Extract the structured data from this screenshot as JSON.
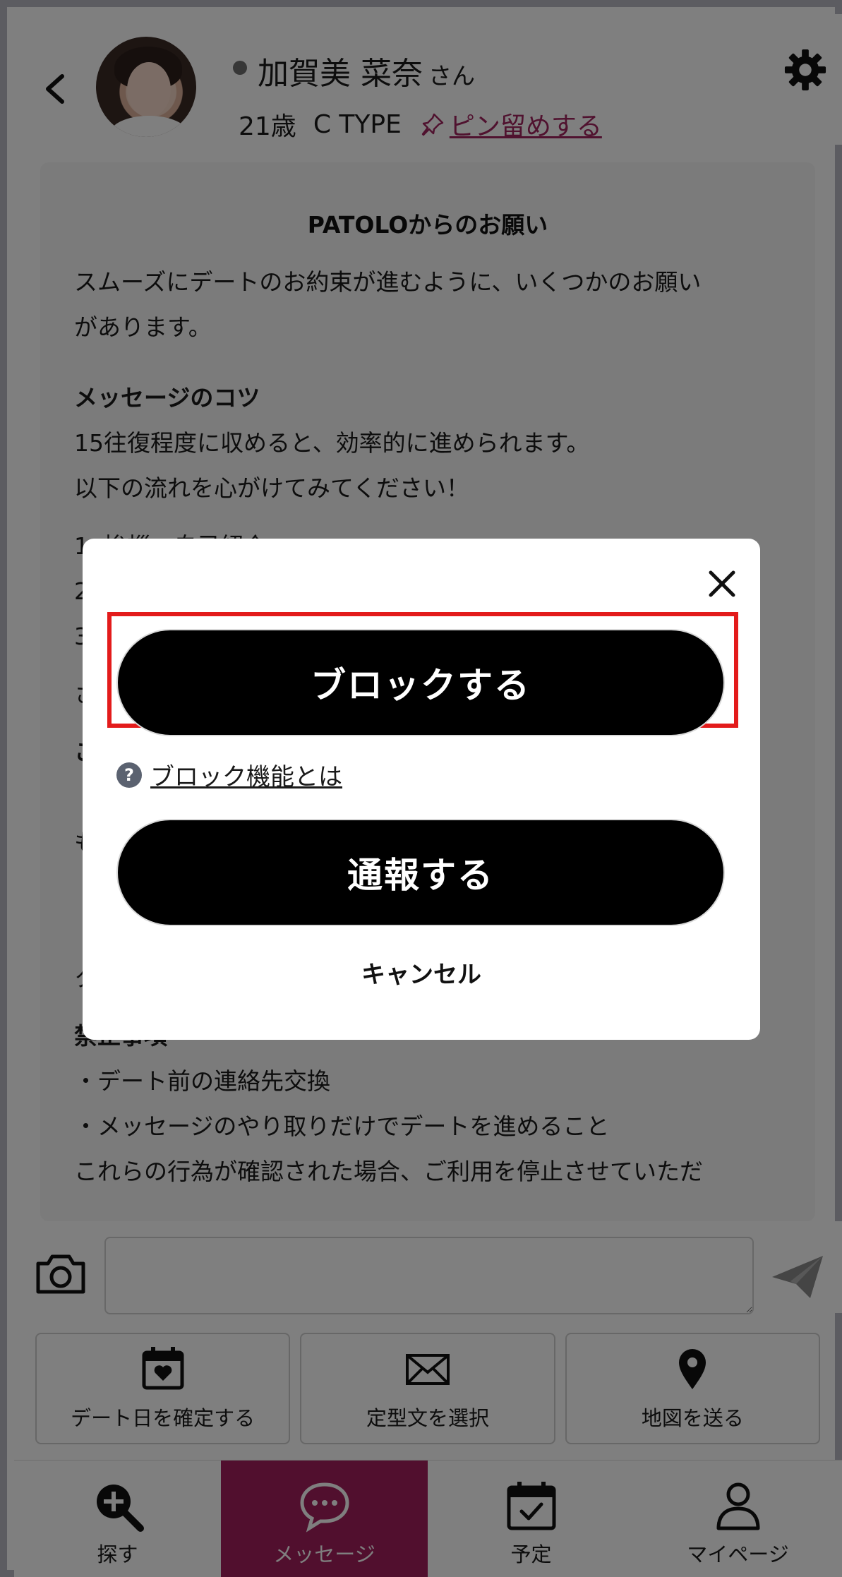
{
  "header": {
    "name": "加賀美 菜奈",
    "honorific": "さん",
    "age": "21歳",
    "type": "C TYPE",
    "pin_label": "ピン留めする"
  },
  "notice": {
    "title": "PATOLOからのお願い",
    "intro_line1": "スムーズにデートのお約束が進むように、いくつかのお願い",
    "intro_line2": "があります。",
    "tips_heading": "メッセージのコツ",
    "tips_line1": "15往復程度に収めると、効率的に進められます。",
    "tips_line2": "以下の流れを心がけてみてください！",
    "step1": "1. 挨拶・自己紹介",
    "step2": "2.",
    "step3": "3.",
    "partial_1": "さ",
    "partial_2": "こ",
    "partial_3": "・",
    "partial_4": "も",
    "partial_5": "・",
    "partial_6": "・",
    "partial_7": "ク",
    "prohibited_heading": "禁止事項",
    "prohibited_1": "・デート前の連絡先交換",
    "prohibited_2": "・メッセージのやり取りだけでデートを進めること",
    "prohibited_3": "これらの行為が確認された場合、ご利用を停止させていただ"
  },
  "quick_actions": {
    "confirm_date": "デート日を確定する",
    "template": "定型文を選択",
    "send_map": "地図を送る"
  },
  "nav": {
    "search": "探す",
    "message": "メッセージ",
    "schedule": "予定",
    "mypage": "マイページ"
  },
  "modal": {
    "block_label": "ブロックする",
    "help_label": "ブロック機能とは",
    "report_label": "通報する",
    "cancel_label": "キャンセル"
  },
  "colors": {
    "accent": "#a31e5c",
    "pin_link": "#a0245f",
    "highlight": "#e31b1b"
  }
}
